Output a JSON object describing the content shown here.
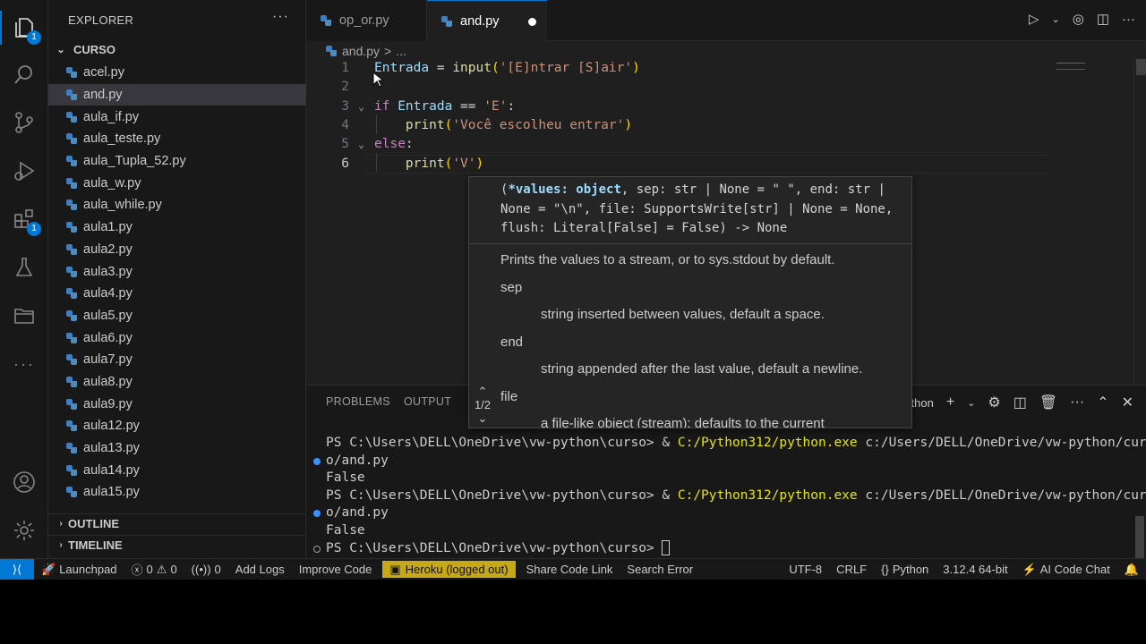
{
  "explorer": {
    "title": "EXPLORER",
    "more": "···",
    "folder": "CURSO",
    "files": [
      "acel.py",
      "and.py",
      "aula_if.py",
      "aula_teste.py",
      "aula_Tupla_52.py",
      "aula_w.py",
      "aula_while.py",
      "aula1.py",
      "aula2.py",
      "aula3.py",
      "aula4.py",
      "aula5.py",
      "aula6.py",
      "aula7.py",
      "aula8.py",
      "aula9.py",
      "aula12.py",
      "aula13.py",
      "aula14.py",
      "aula15.py"
    ],
    "selected_file": "and.py",
    "outline": "OUTLINE",
    "timeline": "TIMELINE"
  },
  "activity_badges": {
    "explorer": "1",
    "extensions": "1"
  },
  "tabs": [
    {
      "label": "op_or.py",
      "active": false
    },
    {
      "label": "and.py",
      "active": true,
      "dirty": true
    }
  ],
  "breadcrumb": {
    "file": "and.py",
    "sep": ">",
    "rest": "..."
  },
  "editor": {
    "line_numbers": [
      "1",
      "2",
      "3",
      "4",
      "5",
      "6"
    ],
    "line1": {
      "var": "Entrada",
      "eq": " = ",
      "fn": "input",
      "open": "(",
      "str": "'[E]ntrar [S]air'",
      "close": ")"
    },
    "line3": {
      "kw": "if",
      "sp": " ",
      "var": "Entrada",
      "op": " == ",
      "str": "'E'",
      "colon": ":"
    },
    "line4": {
      "indent": "    ",
      "fn": "print",
      "open": "(",
      "str": "'Você escolheu entrar'",
      "close": ")"
    },
    "line5": {
      "kw": "else",
      "colon": ":"
    },
    "line6": {
      "indent": "    ",
      "fn": "print",
      "open": "(",
      "str": "'V'",
      "close": ")"
    }
  },
  "hover": {
    "sig_open": "(",
    "sig_values": "*values: object",
    "sig_l1_rest": ", sep: str | None = \" \", end: str |",
    "sig_l2": "None = \"\\n\", file: SupportsWrite[str] | None = None,",
    "sig_l3": "flush: Literal[False] = False) -> None",
    "doc": "Prints the values to a stream, or to sys.stdout by default.",
    "params": [
      {
        "name": "sep",
        "desc": "string inserted between values, default a space."
      },
      {
        "name": "end",
        "desc": "string appended after the last value, default a newline."
      },
      {
        "name": "file",
        "desc": "a file-like object (stream); defaults to the current"
      }
    ],
    "page": "1/2"
  },
  "panel": {
    "tabs": [
      "PROBLEMS",
      "OUTPUT"
    ],
    "terminal_label": "thon"
  },
  "terminal": {
    "prompt": "PS C:\\Users\\DELL\\OneDrive\\vw-python\\curso> ",
    "amp": "& ",
    "exe": "C:/Python312/python.exe",
    "arg": " c:/Users/DELL/OneDrive/vw-python/curs",
    "arg_cont": "o/and.py",
    "output": "False"
  },
  "status": {
    "launchpad": "Launchpad",
    "errors": "0",
    "warnings": "0",
    "ports": "0",
    "add_logs": "Add Logs",
    "improve_code": "Improve Code",
    "heroku": "Heroku (logged out)",
    "share_code": "Share Code Link",
    "search_error": "Search Error",
    "encoding": "UTF-8",
    "eol": "CRLF",
    "language": "Python",
    "interpreter": "3.12.4 64-bit",
    "ai_chat": "AI Code Chat"
  },
  "colors": {
    "accent": "#0078d4",
    "heroku": "#c7a816"
  }
}
